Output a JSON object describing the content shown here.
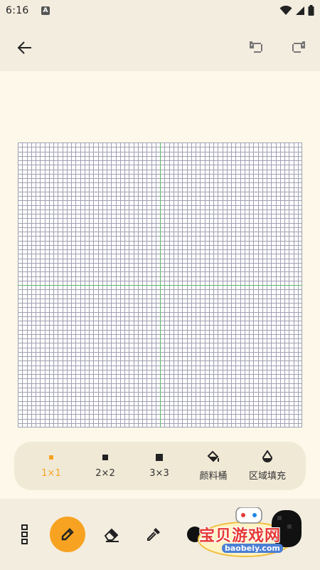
{
  "status_bar": {
    "time": "6:16",
    "notification_badge": "A"
  },
  "toolbar": {
    "back": "arrow-left-icon",
    "undo": "undo-icon",
    "redo": "redo-icon"
  },
  "canvas": {
    "columns": 64,
    "rows": 64,
    "grid_line_color": "#a09fb2",
    "center_guide_color": "#5cb86a",
    "background_color": "#ffffff"
  },
  "brush_options": [
    {
      "label": "1×1",
      "icon": "pixel-1x1-icon",
      "selected": true
    },
    {
      "label": "2×2",
      "icon": "pixel-2x2-icon",
      "selected": false
    },
    {
      "label": "3×3",
      "icon": "pixel-3x3-icon",
      "selected": false
    },
    {
      "label": "颜料桶",
      "icon": "paint-bucket-icon",
      "selected": false
    },
    {
      "label": "区域填充",
      "icon": "drop-fill-icon",
      "selected": false
    }
  ],
  "tools": [
    {
      "icon": "more-vertical-icon"
    },
    {
      "icon": "pencil-icon",
      "active": true
    },
    {
      "icon": "eraser-icon"
    },
    {
      "icon": "eyedropper-icon"
    },
    {
      "icon": "color-swatch-icon"
    }
  ],
  "watermark": {
    "text": "宝贝游戏网",
    "url": "baobeiy.com"
  },
  "colors": {
    "accent": "#f7a321",
    "background": "#fdf8e9",
    "bar": "#f3ede0",
    "panel": "#f0e9d6"
  }
}
